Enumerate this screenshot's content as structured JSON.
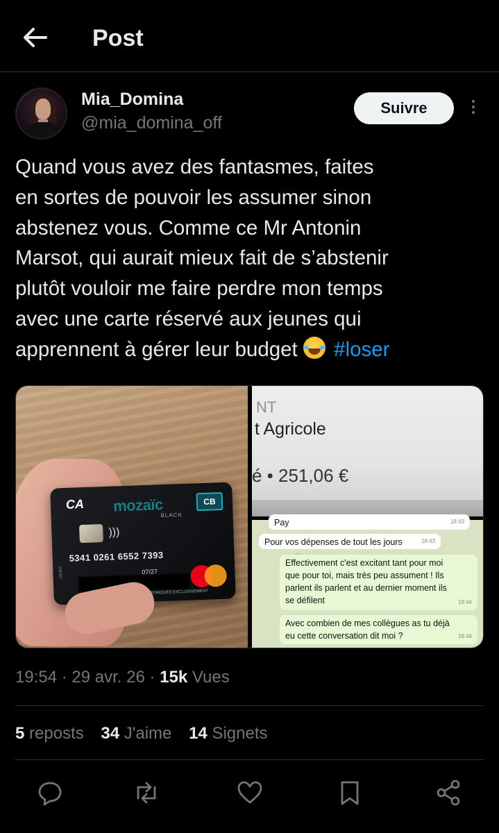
{
  "header": {
    "title": "Post"
  },
  "author": {
    "display_name": "Mia_Domina",
    "handle": "@mia_domina_off",
    "follow_label": "Suivre"
  },
  "tweet": {
    "lines": [
      "Quand vous avez des fantasmes, faites",
      "en sortes de pouvoir les assumer sinon",
      "abstenez vous. Comme ce Mr Antonin",
      "Marsot, qui aurait mieux fait de s’abstenir",
      "plutôt vouloir me faire perdre mon temps",
      "avec une carte réservé aux jeunes qui",
      "apprennent à gérer leur budget"
    ],
    "hashtag": "#loser",
    "emoji": "face-with-tears-of-joy"
  },
  "media": {
    "card": {
      "bank": "CA",
      "brand": "mozaïc",
      "brand_sub": "BLACK",
      "scheme": "CB",
      "number": "5341 0261 6552 7393",
      "expiry": "07/27",
      "footer": "TRANSACTIONS ÉLECTRONIQUES EXCLUSIVEMENT",
      "side": "DEBIT"
    },
    "bank_screen": {
      "line1": "NT",
      "line2": "t Agricole",
      "amount": "é • 251,06 €"
    },
    "chat": [
      {
        "text": "Pay",
        "time": "18:43",
        "dir": "in"
      },
      {
        "text": "Pour vos dépenses de tout les jours",
        "time": "18:43",
        "dir": "in"
      },
      {
        "text": "Effectivement c'est excitant tant pour moi que pour toi, mais très peu assument ! Ils parlent ils parlent et au dernier moment ils se défilent",
        "time": "18:44",
        "dir": "out"
      },
      {
        "text": "Avec combien de mes collègues as tu déjà eu cette conversation dit moi ?",
        "time": "18:44",
        "dir": "out"
      }
    ]
  },
  "meta": {
    "time": "19:54",
    "date": "29 avr. 26",
    "views_count": "15k",
    "views_label": "Vues",
    "dot": "·"
  },
  "stats": [
    {
      "count": "5",
      "label": "reposts"
    },
    {
      "count": "34",
      "label": "J'aime"
    },
    {
      "count": "14",
      "label": "Signets"
    }
  ],
  "actions": [
    "reply-icon",
    "repost-icon",
    "like-icon",
    "bookmark-icon",
    "share-icon"
  ],
  "colors": {
    "background": "#000000",
    "text": "#e7e9ea",
    "muted": "#71767b",
    "accent": "#1d9bf0",
    "divider": "#2f3336"
  }
}
